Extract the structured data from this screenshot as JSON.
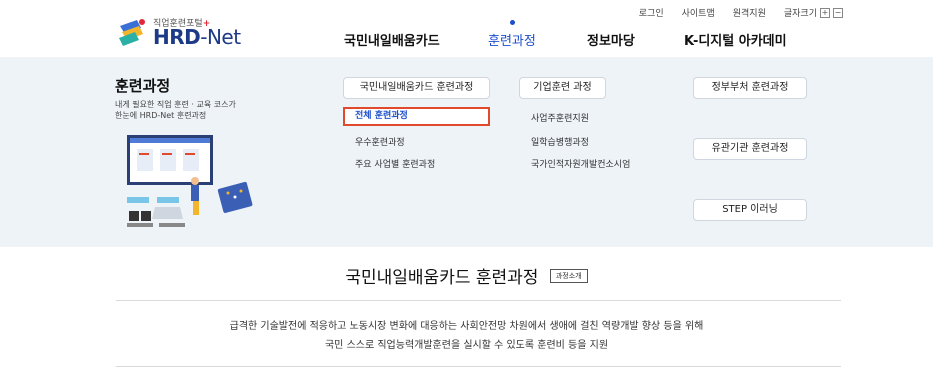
{
  "utility": {
    "login": "로그인",
    "sitemap": "사이트맵",
    "remote_support": "원격지원",
    "font_size_label": "글자크기",
    "font_plus": "+",
    "font_minus": "−"
  },
  "logo": {
    "subtitle": "직업훈련포털",
    "subtitle_plus": "+",
    "hrd": "HRD",
    "dash": "-",
    "net": "Net"
  },
  "gnb": [
    {
      "label": "국민내일배움카드"
    },
    {
      "label": "훈련과정"
    },
    {
      "label": "정보마당"
    },
    {
      "label": "K-디지털 아카데미"
    }
  ],
  "panel": {
    "title": "훈련과정",
    "desc_line1": "내게 필요한 직업 훈련 · 교육 코스가",
    "desc_line2": "한눈에 HRD-Net 훈련과정",
    "col1": {
      "header": "국민내일배움카드 훈련과정",
      "links": [
        "전체 훈련과정",
        "우수훈련과정",
        "주요 사업별 훈련과정"
      ]
    },
    "col2": {
      "header": "기업훈련 과정",
      "links": [
        "사업주훈련지원",
        "일학습병행과정",
        "국가인적자원개발컨소시엄"
      ]
    },
    "col3": {
      "buttons": [
        "정부부처 훈련과정",
        "유관기관 훈련과정",
        "STEP 이러닝"
      ]
    }
  },
  "content": {
    "title": "국민내일배움카드 훈련과정",
    "intro_button": "과정소개",
    "desc_line1": "급격한 기술발전에 적응하고 노동시장 변화에 대응하는 사회안전망 차원에서 생애에 걸친 역량개발 향상 등을 위해",
    "desc_line2": "국민 스스로 직업능력개발훈련을 실시할 수 있도록 훈련비 등을 지원"
  },
  "colors": {
    "accent": "#1d4fcc",
    "highlight_border": "#e24a2e",
    "panel_bg": "#eef3f8"
  },
  "icons": [
    "logo-mark-icon",
    "font-plus-icon",
    "font-minus-icon"
  ]
}
